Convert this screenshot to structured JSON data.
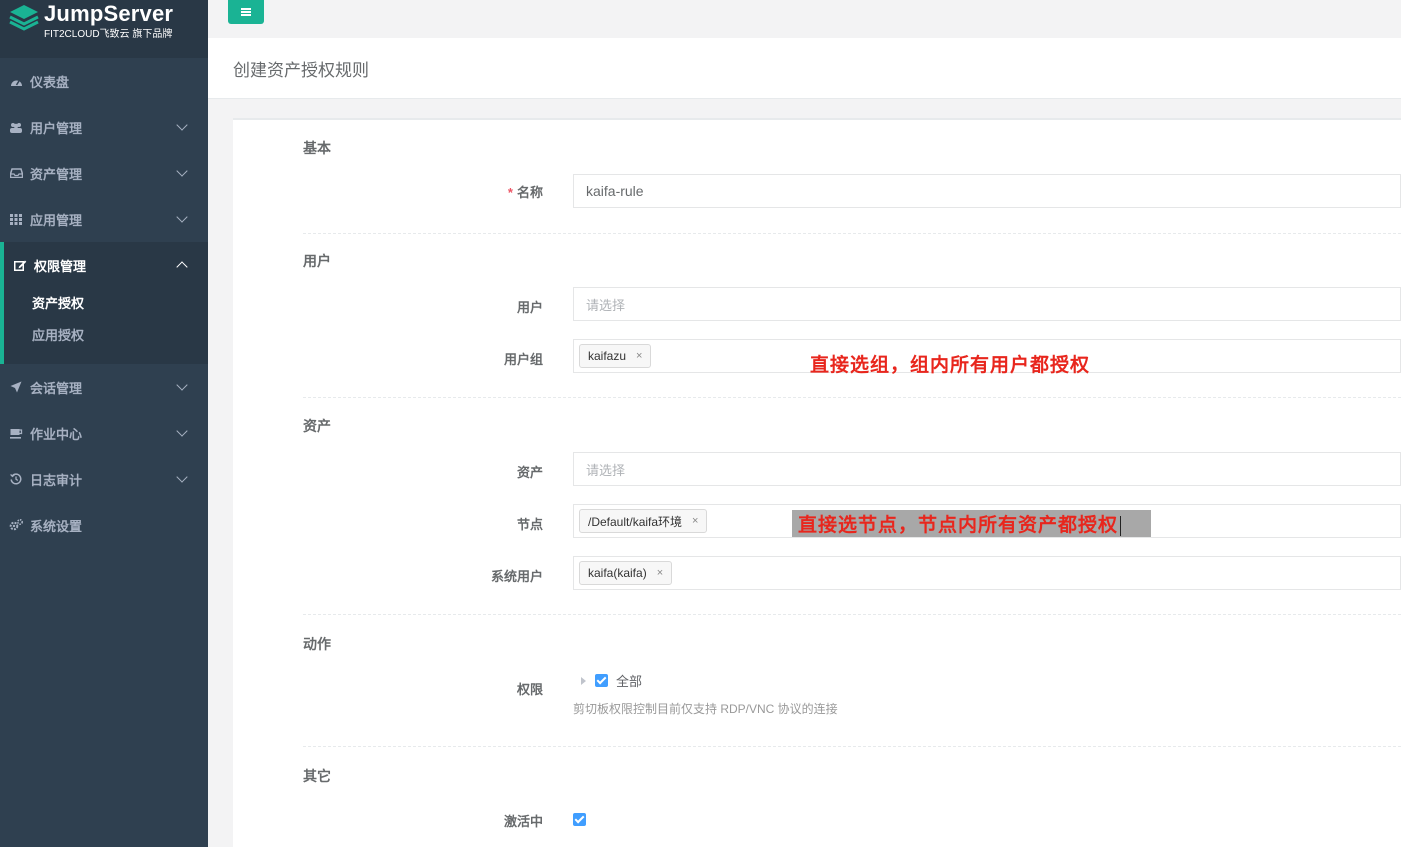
{
  "brand": {
    "title": "JumpServer",
    "subtitle": "FIT2CLOUD飞致云 旗下品牌"
  },
  "sidebar": {
    "items": [
      {
        "label": "仪表盘",
        "icon": "dashboard-icon"
      },
      {
        "label": "用户管理",
        "icon": "users-icon"
      },
      {
        "label": "资产管理",
        "icon": "inbox-icon"
      },
      {
        "label": "应用管理",
        "icon": "grid-icon"
      },
      {
        "label": "权限管理",
        "icon": "edit-icon",
        "active": true,
        "children": [
          {
            "label": "资产授权",
            "active": true
          },
          {
            "label": "应用授权"
          }
        ]
      },
      {
        "label": "会话管理",
        "icon": "rocket-icon"
      },
      {
        "label": "作业中心",
        "icon": "coffee-icon"
      },
      {
        "label": "日志审计",
        "icon": "history-icon"
      },
      {
        "label": "系统设置",
        "icon": "gears-icon"
      }
    ]
  },
  "page": {
    "title": "创建资产授权规则"
  },
  "form": {
    "basic": {
      "title": "基本",
      "name_label": "名称",
      "name_value": "kaifa-rule"
    },
    "user": {
      "title": "用户",
      "users_label": "用户",
      "users_placeholder": "请选择",
      "groups_label": "用户组",
      "group_tag": "kaifazu"
    },
    "asset": {
      "title": "资产",
      "assets_label": "资产",
      "assets_placeholder": "请选择",
      "nodes_label": "节点",
      "node_tag": "/Default/kaifa环境",
      "sysuser_label": "系统用户",
      "sysuser_tag": "kaifa(kaifa)"
    },
    "action": {
      "title": "动作",
      "perm_label": "权限",
      "perm_all": "全部",
      "hint": "剪切板权限控制目前仅支持 RDP/VNC 协议的连接"
    },
    "other": {
      "title": "其它",
      "active_label": "激活中"
    }
  },
  "annotations": {
    "group_note": "直接选组，组内所有用户都授权",
    "node_note": "直接选节点，节点内所有资产都授权"
  },
  "colors": {
    "sidebar": "#2f4050",
    "accent": "#1ab394",
    "annotation": "#e8261d",
    "checkbox": "#409eff"
  }
}
